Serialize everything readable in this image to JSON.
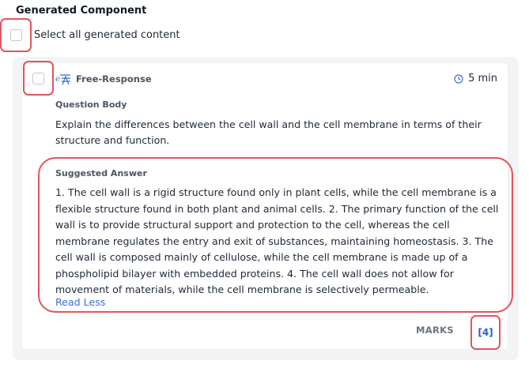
{
  "section": {
    "title": "Generated Component"
  },
  "select_all": {
    "label": "Select all generated content",
    "checked": false
  },
  "question": {
    "type_label": "Free-Response",
    "type_icon": "free-response-icon",
    "time": "5 min",
    "time_icon": "clock-icon",
    "body_label": "Question Body",
    "body_text": "Explain the differences between the cell wall and the cell membrane in terms of their structure and function.",
    "answer_label": "Suggested Answer",
    "answer_text": "1. The cell wall is a rigid structure found only in plant cells, while the cell membrane is a flexible structure found in both plant and animal cells. 2. The primary function of the cell wall is to provide structural support and protection to the cell, whereas the cell membrane regulates the entry and exit of substances, maintaining homeostasis. 3. The cell wall is composed mainly of cellulose, while the cell membrane is made up of a phospholipid bilayer with embedded proteins. 4. The cell wall does not allow for movement of materials, while the cell membrane is selectively permeable.",
    "read_less": "Read Less",
    "marks_label": "MARKS",
    "marks_value": "[4]",
    "checked": false
  },
  "colors": {
    "highlight": "#e0565b",
    "link": "#3b6fd9",
    "marks": "#2f5fbf"
  }
}
